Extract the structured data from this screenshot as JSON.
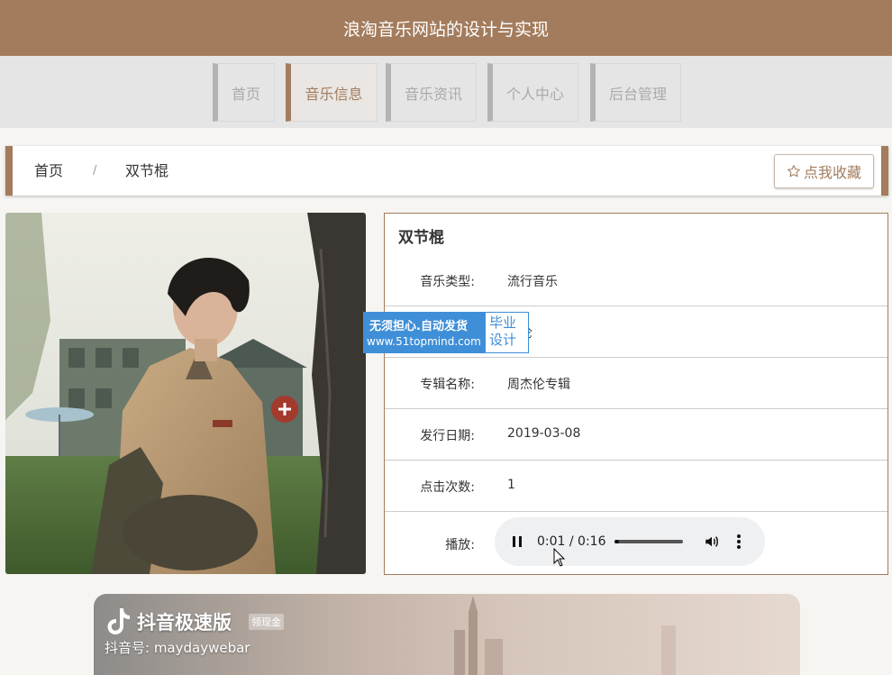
{
  "site": {
    "title": "浪淘音乐网站的设计与实现"
  },
  "nav": {
    "items": [
      {
        "label": "首页"
      },
      {
        "label": "音乐信息"
      },
      {
        "label": "音乐资讯"
      },
      {
        "label": "个人中心"
      },
      {
        "label": "后台管理"
      }
    ]
  },
  "breadcrumb": {
    "home": "首页",
    "separator": "/",
    "current": "双节棍"
  },
  "favorite": {
    "label": "点我收藏",
    "icon": "star-outline-icon"
  },
  "detail": {
    "title": "双节棍",
    "fields": [
      {
        "label": "音乐类型:",
        "value": "流行音乐"
      },
      {
        "label": "",
        "value": "杰伦"
      },
      {
        "label": "专辑名称:",
        "value": "周杰伦专辑"
      },
      {
        "label": "发行日期:",
        "value": "2019-03-08"
      },
      {
        "label": "点击次数:",
        "value": "1"
      }
    ],
    "play_label": "播放:"
  },
  "player": {
    "time": "0:01 / 0:16",
    "progress": 0.06
  },
  "watermark": {
    "line1": "无须担心.自动发货",
    "line2": "www.51topmind.com",
    "right1": "毕业",
    "right2": "设计"
  },
  "banner": {
    "title": "抖音极速版",
    "badge": "领现金",
    "subtitle": "抖音号: maydaywebar"
  },
  "colors": {
    "brand": "#a37c5d",
    "watermark": "#3f8fd8"
  }
}
